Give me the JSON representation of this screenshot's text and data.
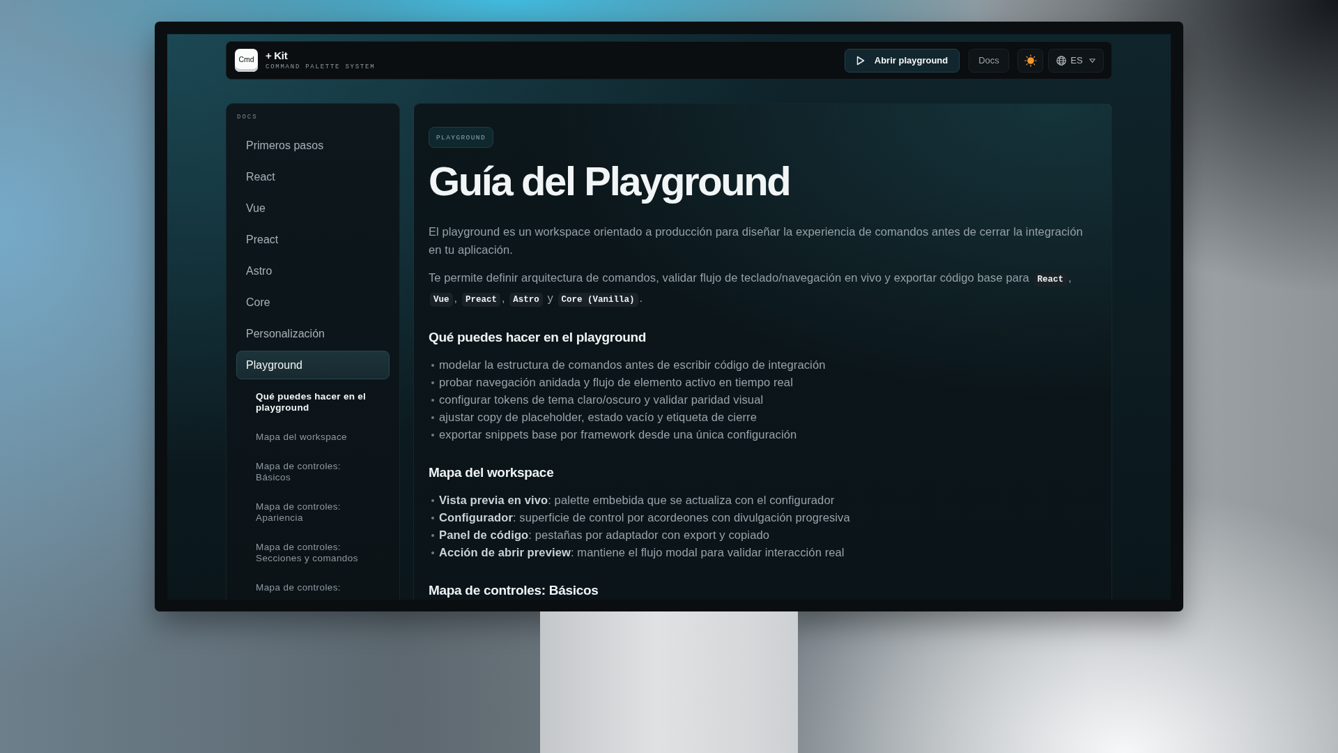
{
  "header": {
    "logo": {
      "key_label": "Cmd",
      "name": "+ Kit",
      "tagline": "COMMAND PALETTE SYSTEM"
    },
    "actions": [
      {
        "kind": "primary",
        "label": "Abrir playground"
      },
      {
        "kind": "link",
        "label": "Docs"
      },
      {
        "kind": "theme"
      },
      {
        "kind": "language",
        "label": "ES"
      }
    ]
  },
  "sidebar": {
    "heading": "DOCS",
    "items": [
      {
        "label": "Primeros pasos",
        "selected": false
      },
      {
        "label": "React",
        "selected": false
      },
      {
        "label": "Vue",
        "selected": false
      },
      {
        "label": "Preact",
        "selected": false
      },
      {
        "label": "Astro",
        "selected": false
      },
      {
        "label": "Core",
        "selected": false
      },
      {
        "label": "Personalización",
        "selected": false
      },
      {
        "label": "Playground",
        "selected": true,
        "children": [
          {
            "label": "Qué puedes hacer en el playground",
            "selected": true
          },
          {
            "label": "Mapa del workspace",
            "selected": false
          },
          {
            "label": "Mapa de controles: Básicos",
            "selected": false
          },
          {
            "label": "Mapa de controles: Apariencia",
            "selected": false
          },
          {
            "label": "Mapa de controles: Secciones y comandos",
            "selected": false
          },
          {
            "label": "Mapa de controles:",
            "selected": false
          }
        ]
      }
    ]
  },
  "article": {
    "badge": "PLAYGROUND",
    "title": "Guía del Playground",
    "paragraphs": [
      {
        "segments": [
          {
            "kind": "text",
            "text": "El playground es un workspace orientado a producción para diseñar la experiencia de comandos antes de cerrar la integración en tu aplicación."
          }
        ]
      },
      {
        "segments": [
          {
            "kind": "text",
            "text": "Te permite definir arquitectura de comandos, validar flujo de teclado/navegación en vivo y exportar código base para "
          },
          {
            "kind": "code",
            "text": "React"
          },
          {
            "kind": "text",
            "text": ", "
          },
          {
            "kind": "code",
            "text": "Vue"
          },
          {
            "kind": "text",
            "text": ", "
          },
          {
            "kind": "code",
            "text": "Preact"
          },
          {
            "kind": "text",
            "text": ", "
          },
          {
            "kind": "code",
            "text": "Astro"
          },
          {
            "kind": "text",
            "text": " y "
          },
          {
            "kind": "code",
            "text": "Core (Vanilla)"
          },
          {
            "kind": "text",
            "text": "."
          }
        ]
      }
    ],
    "sections": [
      {
        "heading": "Qué puedes hacer en el playground",
        "bullets": [
          "modelar la estructura de comandos antes de escribir código de integración",
          "probar navegación anidada y flujo de elemento activo en tiempo real",
          "configurar tokens de tema claro/oscuro y validar paridad visual",
          "ajustar copy de placeholder, estado vacío y etiqueta de cierre",
          "exportar snippets base por framework desde una única configuración"
        ]
      },
      {
        "heading": "Mapa del workspace",
        "bullets": [
          "**Vista previa en vivo**: palette embebida que se actualiza con el configurador",
          "**Configurador**: superficie de control por acordeones con divulgación progresiva",
          "**Panel de código**: pestañas por adaptador con export y copiado",
          "**Acción de abrir preview**: mantiene el flujo modal para validar interacción real"
        ]
      },
      {
        "heading": "Mapa de controles: Básicos"
      }
    ]
  }
}
